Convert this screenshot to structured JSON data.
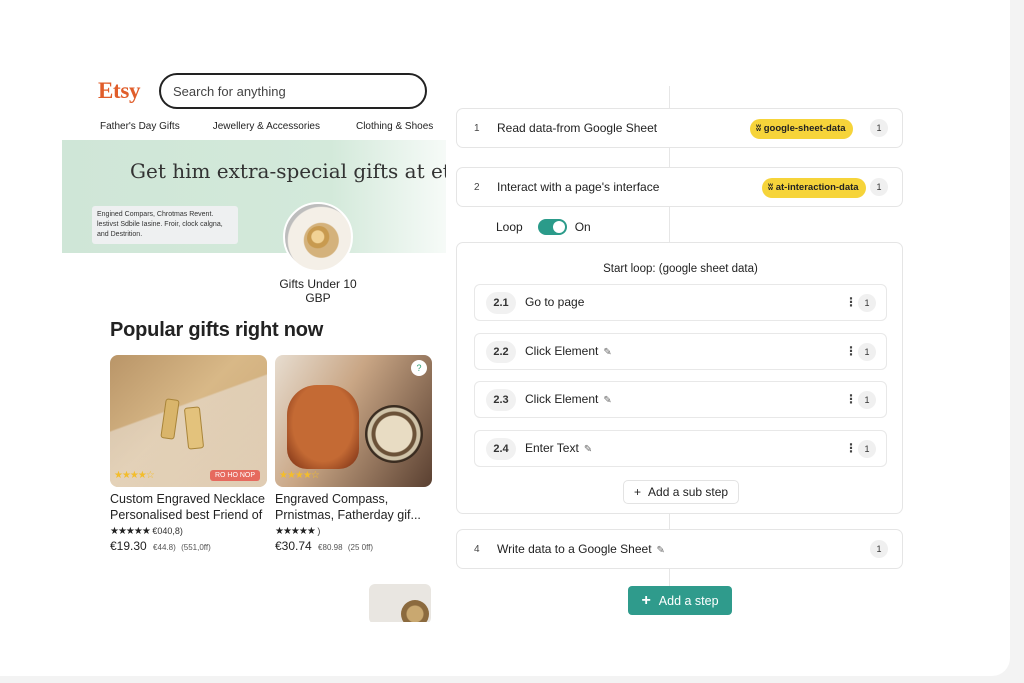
{
  "etsy": {
    "logo": "Etsy",
    "search_placeholder": "Search for anything",
    "categories": [
      "Father's Day Gifts",
      "Jewellery & Accessories",
      "Clothing & Shoes"
    ],
    "banner_title": "Get him extra-special gifts at et",
    "banner_note": "Engined Compars, Chrotmas Revent. lestivst Sdbile Iasine. Froir, clock calgna, and Destrition.",
    "gift_label": "Gifts Under 10 GBP",
    "popular_heading": "Popular gifts right now",
    "products": [
      {
        "title_line1": "Custom Engraved Necklace",
        "title_line2": "Personalised best Friend of",
        "image_stars": "★★★★☆",
        "sale_tag": "RO HO NOP",
        "rating_stars": "★★★★★",
        "rating_text": "€040,8)",
        "price": "€19.30",
        "old_price": "€44.8)",
        "discount": "(551,0ff)"
      },
      {
        "title_line1": "Engraved Compass,",
        "title_line2": "Prnistmas, Fatherday gif...",
        "image_stars": "★★★★☆",
        "rating_stars": "★★★★★",
        "rating_text": ")",
        "price": "€30.74",
        "old_price": "€80.98",
        "discount": "(25 0ff)"
      }
    ]
  },
  "workflow": {
    "steps": [
      {
        "num": "1",
        "label": "Read data-from Google Sheet",
        "pill": "google-sheet-data",
        "count": "1"
      },
      {
        "num": "2",
        "label": "Interact with a page's interface",
        "pill": "at-interaction-data",
        "count": "1"
      }
    ],
    "loop_label": "Loop",
    "loop_state": "On",
    "loop_title": "Start loop: (google sheet data)",
    "substeps": [
      {
        "num": "2.1",
        "label": "Go to page",
        "count": "1"
      },
      {
        "num": "2.2",
        "label": "Click Element",
        "count": "1"
      },
      {
        "num": "2.3",
        "label": "Click Element",
        "count": "1"
      },
      {
        "num": "2.4",
        "label": "Enter Text",
        "count": "1"
      }
    ],
    "add_sub_step": "Add a sub step",
    "step4": {
      "num": "4",
      "label": "Write data to a Google Sheet",
      "count": "1"
    },
    "add_step": "Add a step",
    "accent": "#2f9b8c",
    "pill_color": "#f6d43a"
  }
}
